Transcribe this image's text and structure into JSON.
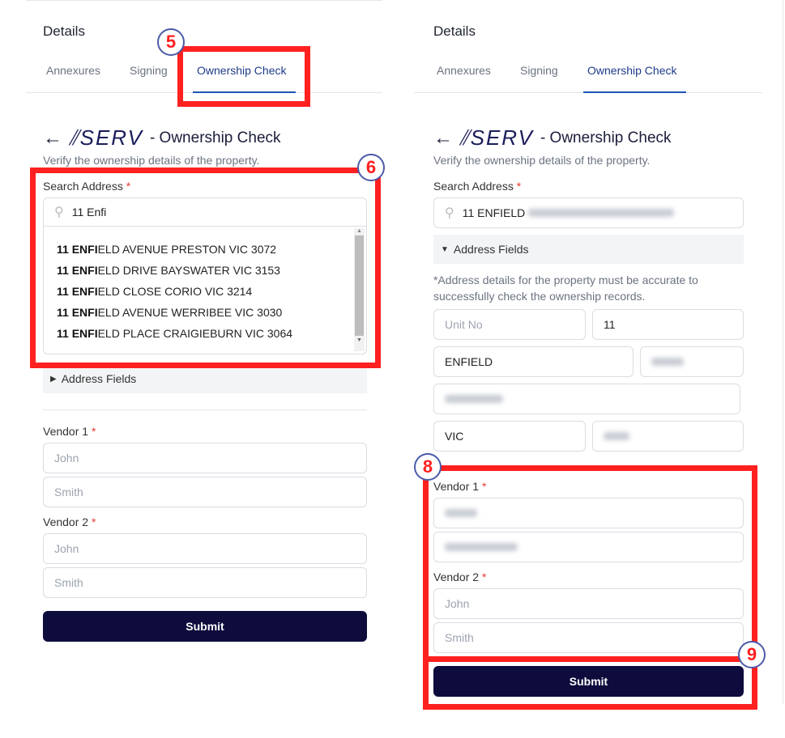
{
  "colors": {
    "accent": "#1d55b5",
    "submit": "#0e0c3d",
    "annotation": "#ff2020",
    "required": "#e53935"
  },
  "left": {
    "heading": "Details",
    "tabs": [
      {
        "label": "Annexures"
      },
      {
        "label": "Signing"
      },
      {
        "label": "Ownership Check",
        "active": true
      }
    ],
    "logo": "SERV",
    "title": "- Ownership Check",
    "subtitle": "Verify the ownership details of the property.",
    "search_label": "Search Address",
    "required_mark": "*",
    "search_value": "11 Enfi",
    "suggestions": [
      {
        "bold": "11 ENFI",
        "rest": "ELD AVENUE PRESTON VIC 3072"
      },
      {
        "bold": "11 ENFI",
        "rest": "ELD DRIVE BAYSWATER VIC 3153"
      },
      {
        "bold": "11 ENFI",
        "rest": "ELD CLOSE CORIO VIC 3214"
      },
      {
        "bold": "11 ENFI",
        "rest": "ELD AVENUE WERRIBEE VIC 3030"
      },
      {
        "bold": "11 ENFI",
        "rest": "ELD PLACE CRAIGIEBURN VIC 3064"
      }
    ],
    "address_fields": "Address Fields",
    "vendor1": "Vendor 1",
    "vendor2": "Vendor 2",
    "first_ph": "John",
    "last_ph": "Smith",
    "submit": "Submit"
  },
  "right": {
    "heading": "Details",
    "tabs": [
      {
        "label": "Annexures"
      },
      {
        "label": "Signing"
      },
      {
        "label": "Ownership Check",
        "active": true
      }
    ],
    "logo": "SERV",
    "title": "- Ownership Check",
    "subtitle": "Verify the ownership details of the property.",
    "search_label": "Search Address",
    "required_mark": "*",
    "search_value": "11 ENFIELD",
    "address_fields": "Address Fields",
    "note": "*Address details for the property must be accurate to successfully check the ownership records.",
    "unit_ph": "Unit No",
    "street_no": "11",
    "street_name": "ENFIELD",
    "state": "VIC",
    "vendor1": "Vendor 1",
    "vendor2": "Vendor 2",
    "first_ph": "John",
    "last_ph": "Smith",
    "submit": "Submit"
  },
  "annotations": [
    "5",
    "6",
    "8",
    "9"
  ]
}
